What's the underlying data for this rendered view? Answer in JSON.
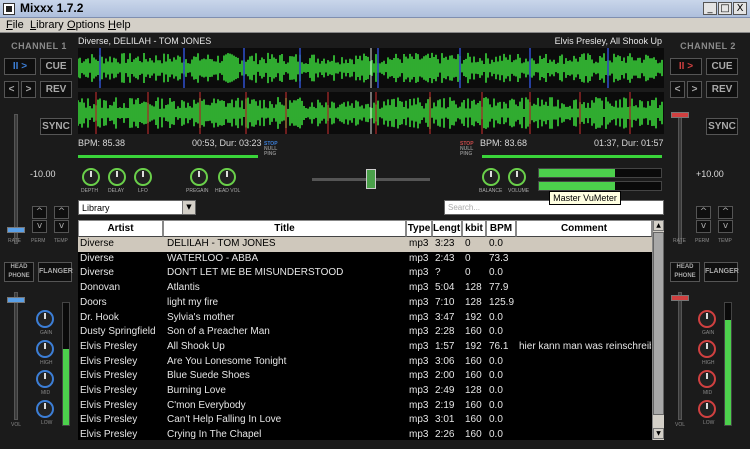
{
  "window": {
    "title": "Mixxx 1.7.2",
    "min_label": "_",
    "max_label": "□",
    "close_label": "X"
  },
  "menu": [
    "File",
    "Library",
    "Options",
    "Help"
  ],
  "channel1": {
    "label": "CHANNEL 1",
    "play_label": "II >",
    "cue_label": "CUE",
    "prev_label": "<",
    "next_label": ">",
    "rev_label": "REV",
    "sync_label": "SYNC",
    "rate_value": "-10.00",
    "rate_label": "RATE",
    "perm_label": "PERM",
    "temp_label": "TEMP",
    "headphone_label": "HEAD PHONE",
    "flanger_label": "FLANGER",
    "gain_label": "GAIN",
    "high_label": "HIGH",
    "mid_label": "MID",
    "low_label": "LOW",
    "vol_label": "VOL",
    "vu_level": 0.62
  },
  "channel2": {
    "label": "CHANNEL 2",
    "play_label": "II >",
    "cue_label": "CUE",
    "prev_label": "<",
    "next_label": ">",
    "rev_label": "REV",
    "sync_label": "SYNC",
    "rate_value": "+10.00",
    "rate_label": "RATE",
    "perm_label": "PERM",
    "temp_label": "TEMP",
    "headphone_label": "HEAD PHONE",
    "flanger_label": "FLANGER",
    "gain_label": "GAIN",
    "high_label": "HIGH",
    "mid_label": "MID",
    "low_label": "LOW",
    "vol_label": "VOL",
    "vu_level": 0.86
  },
  "deck1": {
    "track": "Diverse, DELILAH -  TOM JONES",
    "bpm": "BPM:  85.38",
    "time": "00:53, Dur: 03:23"
  },
  "deck2": {
    "track": "Elvis Presley, All Shook Up",
    "bpm": "BPM:  83.68",
    "time": "01:37, Dur: 01:57"
  },
  "sync_indicator": [
    "STOP",
    "NULL",
    "PING"
  ],
  "mixer": {
    "depth": "DEPTH",
    "delay": "DELAY",
    "lfo": "LFO",
    "pregain": "PREGAIN",
    "headvol": "HEAD VOL",
    "balance": "BALANCE",
    "volume": "VOLUME",
    "crossfader_position": 0.5,
    "master_vu_left": 0.62,
    "master_vu_right": 0.62
  },
  "library": {
    "selector": "Library",
    "search_placeholder": "Search...",
    "tooltip": "Master VuMeter",
    "columns": [
      "Artist",
      "Title",
      "Type",
      "Length",
      "kbit",
      "BPM",
      "Comment"
    ],
    "rows": [
      {
        "artist": "Diverse",
        "title": "DELILAH -  TOM JONES",
        "type": "mp3",
        "length": "3:23",
        "kbit": "0",
        "bpm": "0.0",
        "comment": "",
        "selected": true
      },
      {
        "artist": "Diverse",
        "title": "WATERLOO -  ABBA",
        "type": "mp3",
        "length": "2:43",
        "kbit": "0",
        "bpm": "73.3",
        "comment": ""
      },
      {
        "artist": "Diverse",
        "title": "DON'T LET ME BE MISUNDERSTOOD",
        "type": "mp3",
        "length": "?",
        "kbit": "0",
        "bpm": "0.0",
        "comment": ""
      },
      {
        "artist": "Donovan",
        "title": "Atlantis",
        "type": "mp3",
        "length": "5:04",
        "kbit": "128",
        "bpm": "77.9",
        "comment": ""
      },
      {
        "artist": "Doors",
        "title": "light my fire",
        "type": "mp3",
        "length": "7:10",
        "kbit": "128",
        "bpm": "125.9",
        "comment": ""
      },
      {
        "artist": "Dr. Hook",
        "title": "Sylvia's mother",
        "type": "mp3",
        "length": "3:47",
        "kbit": "192",
        "bpm": "0.0",
        "comment": ""
      },
      {
        "artist": "Dusty Springfield",
        "title": "Son of a Preacher Man",
        "type": "mp3",
        "length": "2:28",
        "kbit": "160",
        "bpm": "0.0",
        "comment": ""
      },
      {
        "artist": "Elvis Presley",
        "title": "All Shook Up",
        "type": "mp3",
        "length": "1:57",
        "kbit": "192",
        "bpm": "76.1",
        "comment": "hier kann man was reinschreiben"
      },
      {
        "artist": "Elvis Presley",
        "title": "Are You Lonesome Tonight",
        "type": "mp3",
        "length": "3:06",
        "kbit": "160",
        "bpm": "0.0",
        "comment": ""
      },
      {
        "artist": "Elvis Presley",
        "title": "Blue Suede Shoes",
        "type": "mp3",
        "length": "2:00",
        "kbit": "160",
        "bpm": "0.0",
        "comment": ""
      },
      {
        "artist": "Elvis Presley",
        "title": "Burning Love",
        "type": "mp3",
        "length": "2:49",
        "kbit": "128",
        "bpm": "0.0",
        "comment": ""
      },
      {
        "artist": "Elvis Presley",
        "title": "C'mon Everybody",
        "type": "mp3",
        "length": "2:19",
        "kbit": "160",
        "bpm": "0.0",
        "comment": ""
      },
      {
        "artist": "Elvis Presley",
        "title": "Can't Help Falling In Love",
        "type": "mp3",
        "length": "3:01",
        "kbit": "160",
        "bpm": "0.0",
        "comment": ""
      },
      {
        "artist": "Elvis Presley",
        "title": "Crying In The Chapel",
        "type": "mp3",
        "length": "2:26",
        "kbit": "160",
        "bpm": "0.0",
        "comment": ""
      }
    ]
  },
  "colors": {
    "waveform": "#3ad43a",
    "beat_marker": "#d03030",
    "cue_marker": "#3050d0",
    "accent_blue": "#3c7ed6"
  }
}
